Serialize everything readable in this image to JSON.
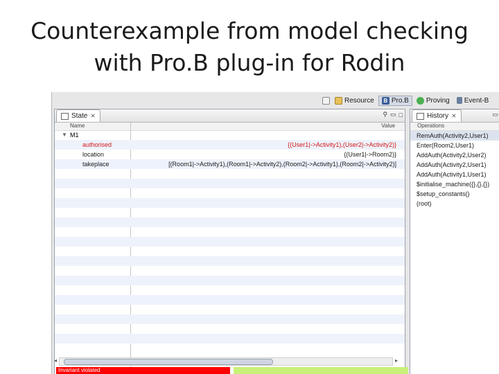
{
  "slide": {
    "title_line1": "Counterexample from model checking",
    "title_line2": "with Pro.B plug-in for Rodin"
  },
  "perspectives": [
    {
      "label": "Resource",
      "icon": "resource-icon"
    },
    {
      "label": "Pro.B",
      "icon": "prob-icon",
      "active": true
    },
    {
      "label": "Proving",
      "icon": "proving-icon"
    },
    {
      "label": "Event-B",
      "icon": "eventb-icon"
    }
  ],
  "state_view": {
    "tab_label": "State",
    "close_glyph": "⨯",
    "header_name": "Name",
    "header_value": "Value",
    "root": "M1",
    "rows": [
      {
        "name": "authorised",
        "value": "{(User1|->Activity1),(User2|->Activity2)}",
        "changed": true
      },
      {
        "name": "location",
        "value": "{(User1|->Room2)}",
        "changed": false
      },
      {
        "name": "takeplace",
        "value": "[(Room1|->Activity1),(Room1|->Activity2),(Room2|->Activity1),(Room2|->Activity2)]",
        "changed": false
      }
    ],
    "status_text": "Invariant violated"
  },
  "history_view": {
    "tab_label": "History",
    "close_glyph": "⨯",
    "header": "Operations",
    "items": [
      "RemAuth(Activity2,User1)",
      "Enter(Room2,User1)",
      "AddAuth(Activity2,User2)",
      "AddAuth(Activity2,User1)",
      "AddAuth(Activity1,User1)",
      "$initialise_machine({},{},{})",
      "$setup_constants()",
      "(root)"
    ]
  },
  "colors": {
    "invariant_violated": "#ff0000",
    "ok_status": "#c9f07a",
    "changed_text": "#d11a1a"
  }
}
